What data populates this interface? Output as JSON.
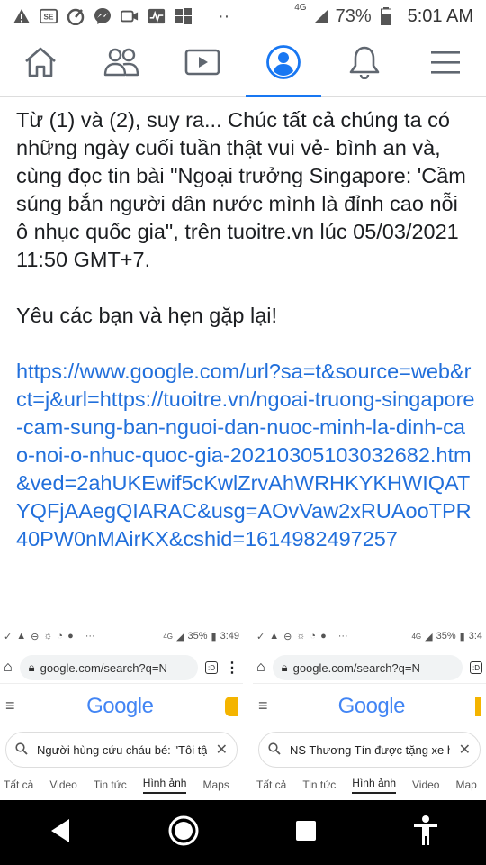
{
  "status_bar": {
    "network": "4G",
    "battery": "73%",
    "time": "5:01 AM",
    "dots": "··"
  },
  "fb_nav": {
    "tabs": [
      {
        "name": "home-icon"
      },
      {
        "name": "friends-icon"
      },
      {
        "name": "watch-icon"
      },
      {
        "name": "profile-icon",
        "active": true
      },
      {
        "name": "notifications-icon"
      },
      {
        "name": "menu-icon"
      }
    ],
    "accent": "#1877f2"
  },
  "post": {
    "paragraph1": "Từ (1) và (2), suy ra... Chúc tất cả chúng ta có những ngày cuối tuần thật vui vẻ- bình an và, cùng đọc tin bài \"Ngoại trưởng Singapore: 'Cầm súng bắn người dân nước mình là đỉnh cao nỗi ô nhục quốc gia\", trên tuoitre.vn lúc 05/03/2021 11:50 GMT+7.",
    "paragraph2": "Yêu các bạn và hẹn gặp lại!",
    "link": "https://www.google.com/url?sa=t&source=web&rct=j&url=https://tuoitre.vn/ngoai-truong-singapore-cam-sung-ban-nguoi-dan-nuoc-minh-la-dinh-cao-noi-o-nhuc-quoc-gia-20210305103032682.htm&ved=2ahUKEwif5cKwlZrvAhWRHKYKHWIQATYQFjAAegQIARAC&usg=AOvVaw2xRUAooTPR40PW0nMAirKX&cshid=1614982497257",
    "link_color": "#216fdb"
  },
  "screenshots": [
    {
      "status_network": "4G",
      "status_battery": "35%",
      "status_time": "3:49",
      "url": "google.com/search?q=N",
      "tab_count": ":D",
      "logo": "Google",
      "query": "Người hùng cứu cháu bé: \"Tôi tậ",
      "tabs": [
        "Tất cả",
        "Video",
        "Tin tức",
        "Hình ảnh",
        "Maps"
      ],
      "selected_tab": "Hình ảnh"
    },
    {
      "status_network": "4G",
      "status_battery": "35%",
      "status_time": "3:4",
      "url": "google.com/search?q=N",
      "tab_count": ":D",
      "logo": "Google",
      "query": "NS Thương Tín được tặng xe hơi",
      "tabs": [
        "Tất cả",
        "Tin tức",
        "Hình ảnh",
        "Video",
        "Map"
      ],
      "selected_tab": "Hình ảnh"
    }
  ],
  "nav_bar": {
    "buttons": [
      "back-icon",
      "home-circle-icon",
      "recents-icon",
      "accessibility-icon"
    ]
  }
}
